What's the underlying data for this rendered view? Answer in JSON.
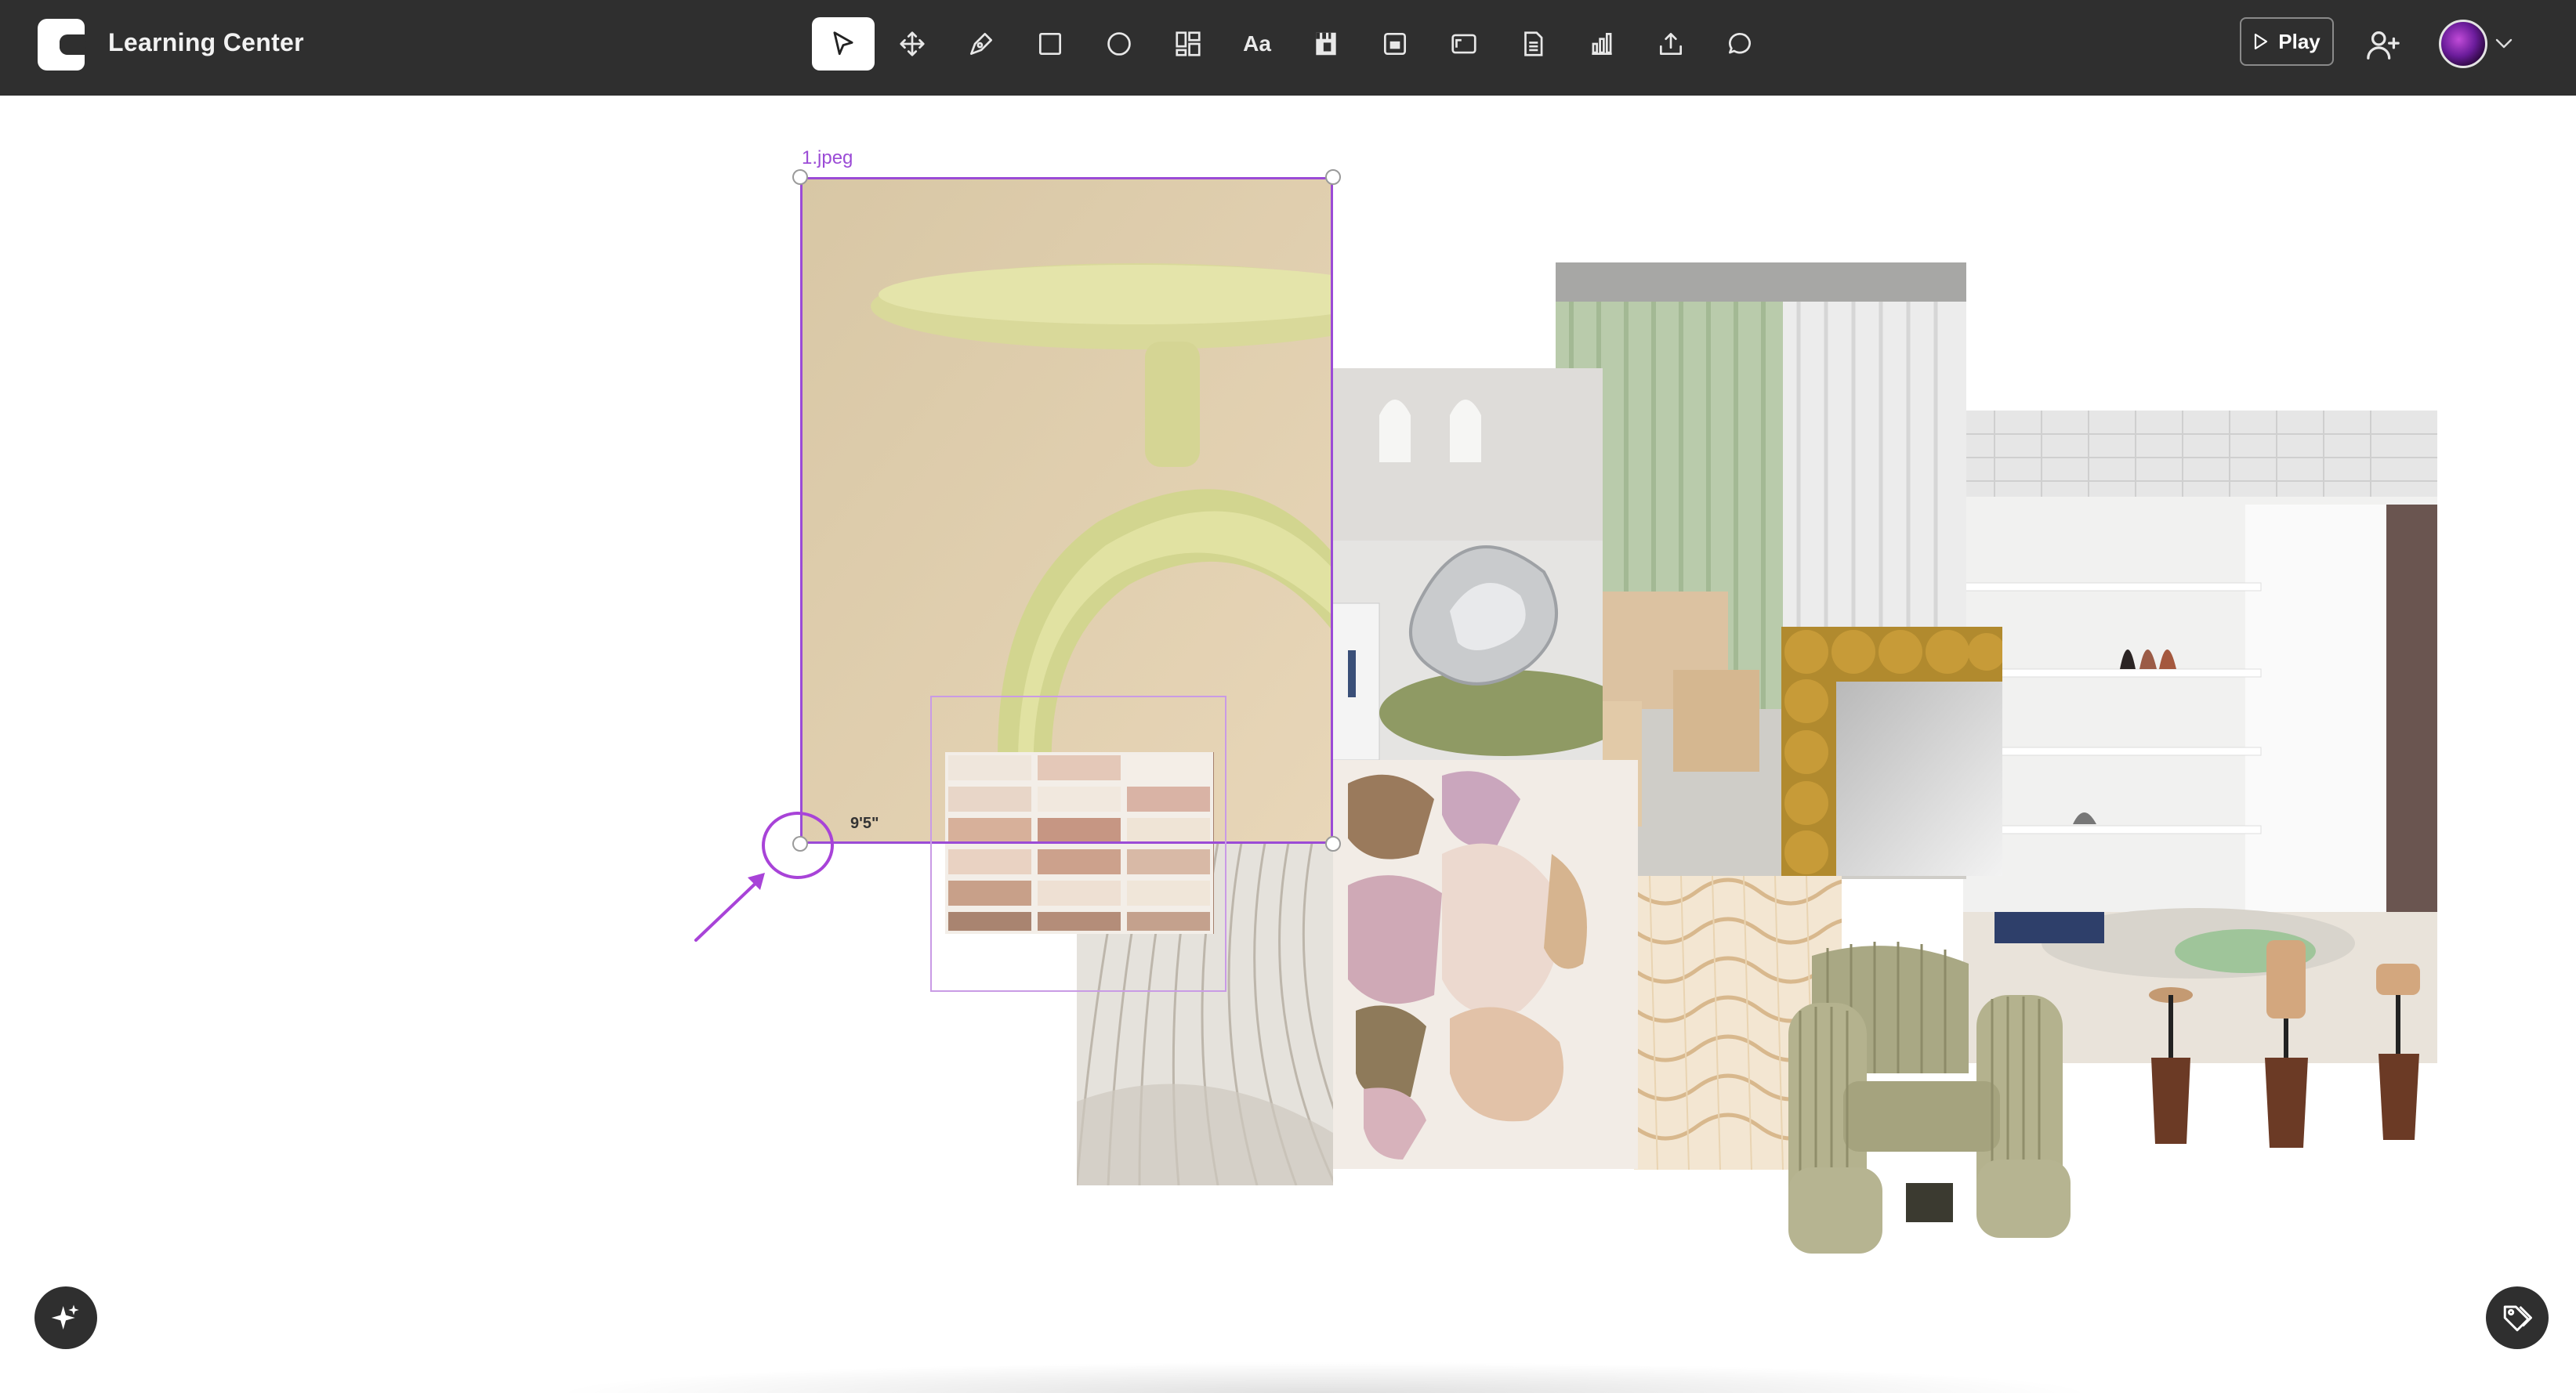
{
  "header": {
    "app_title": "Learning Center",
    "play_label": "Play"
  },
  "toolbar": {
    "tools": [
      {
        "name": "select",
        "icon": "pointer-icon",
        "active": true
      },
      {
        "name": "move",
        "icon": "move-icon"
      },
      {
        "name": "pen",
        "icon": "pen-icon"
      },
      {
        "name": "rectangle",
        "icon": "rectangle-icon"
      },
      {
        "name": "ellipse",
        "icon": "ellipse-icon"
      },
      {
        "name": "layout",
        "icon": "layout-icon"
      },
      {
        "name": "text",
        "icon": "text-icon",
        "label": "Aa"
      },
      {
        "name": "swatch",
        "icon": "swatch-icon"
      },
      {
        "name": "frame",
        "icon": "frame-icon"
      },
      {
        "name": "image",
        "icon": "image-icon"
      },
      {
        "name": "document",
        "icon": "document-icon"
      },
      {
        "name": "chart",
        "icon": "chart-icon"
      },
      {
        "name": "upload",
        "icon": "upload-icon"
      },
      {
        "name": "comment",
        "icon": "comment-icon"
      }
    ]
  },
  "canvas": {
    "selected_file_label": "1.jpeg",
    "dimension_label": "9'5\"",
    "accent_color": "#9b4bd6"
  },
  "images": [
    {
      "id": "chair-ring"
    },
    {
      "id": "tiles"
    },
    {
      "id": "fringe-sculpture"
    },
    {
      "id": "silver-pouf"
    },
    {
      "id": "abstract-collage"
    },
    {
      "id": "curtain-room"
    },
    {
      "id": "bobble-mirror"
    },
    {
      "id": "rope-texture"
    },
    {
      "id": "shelf-interior"
    },
    {
      "id": "armchair"
    },
    {
      "id": "side-tables"
    }
  ],
  "fab": {
    "left_icon": "sparkle-icon",
    "right_icon": "tag-icon"
  }
}
